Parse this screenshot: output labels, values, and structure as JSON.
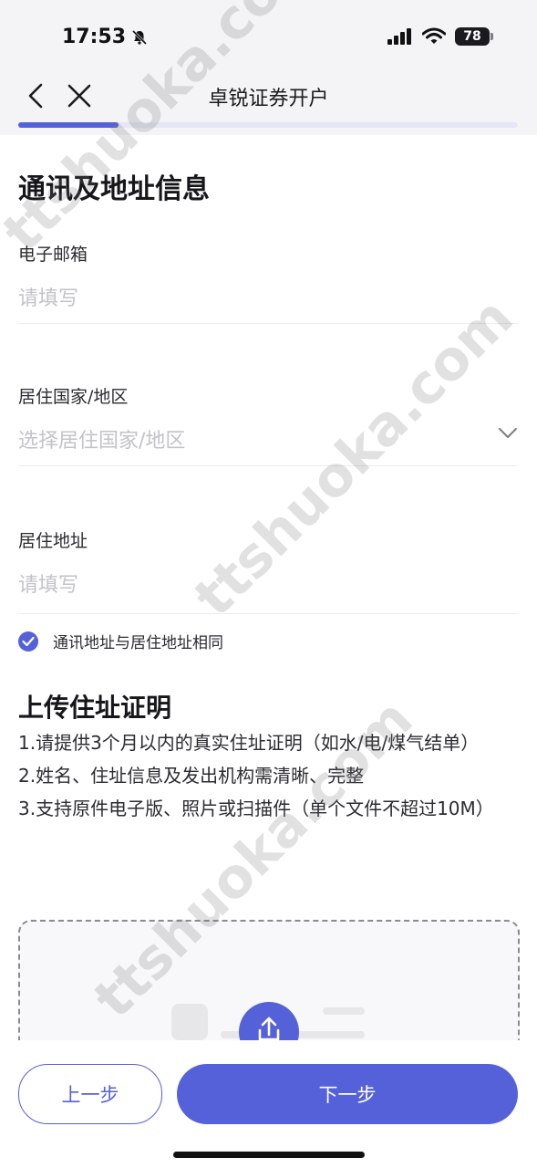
{
  "status_bar": {
    "time": "17:53",
    "battery_level": "78"
  },
  "nav": {
    "title": "卓锐证券开户"
  },
  "progress": {
    "fraction": 0.2
  },
  "section": {
    "title": "通讯及地址信息"
  },
  "fields": {
    "email": {
      "label": "电子邮箱",
      "placeholder": "请填写"
    },
    "country": {
      "label": "居住国家/地区",
      "placeholder": "选择居住国家/地区"
    },
    "address": {
      "label": "居住地址",
      "placeholder": "请填写"
    }
  },
  "same_address": {
    "label": "通讯地址与居住地址相同",
    "checked": true
  },
  "upload": {
    "title": "上传住址证明",
    "notes": [
      "1.请提供3个月以内的真实住址证明（如水/电/煤气结单）",
      "2.姓名、住址信息及发出机构需清晰、完整",
      "3.支持原件电子版、照片或扫描件（单个文件不超过10M）"
    ]
  },
  "footer": {
    "prev_label": "上一步",
    "next_label": "下一步"
  },
  "watermark": {
    "text": "ttshuoka.com"
  },
  "colors": {
    "accent": "#5561d8",
    "placeholder": "#c3c3c8",
    "divider": "#ececef"
  }
}
